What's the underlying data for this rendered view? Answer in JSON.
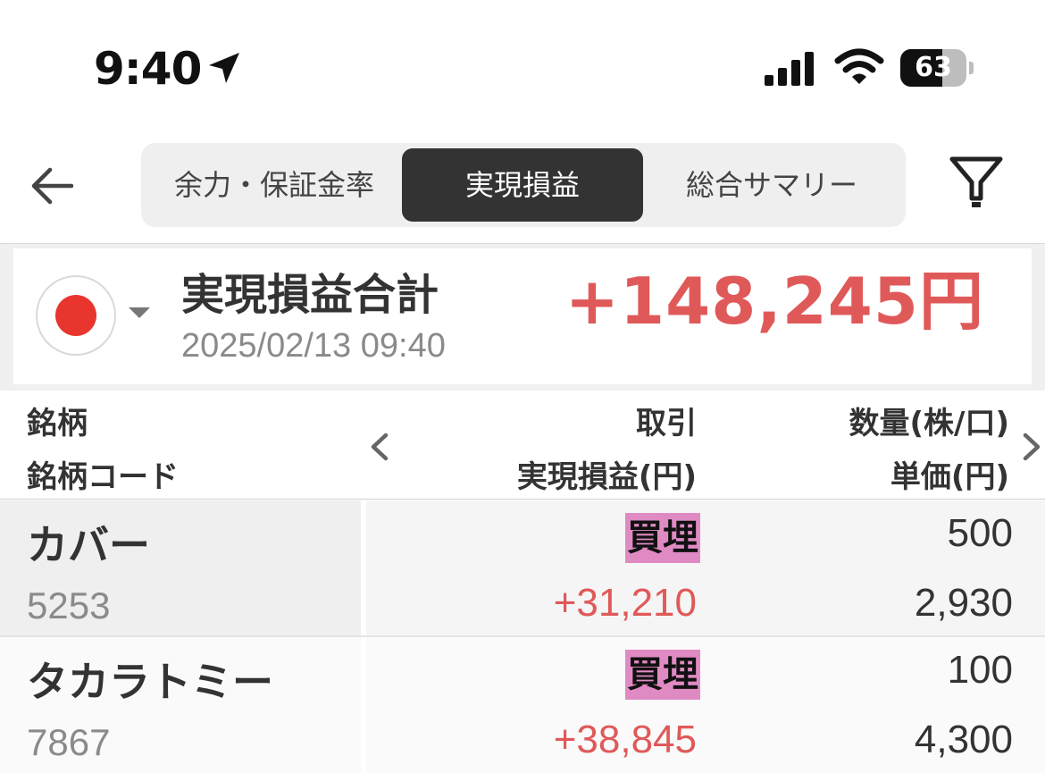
{
  "status_bar": {
    "time": "9:40",
    "battery": "63",
    "battery_level_percent": 63
  },
  "tabs": [
    {
      "label": "余力・保証金率",
      "active": false
    },
    {
      "label": "実現損益",
      "active": true
    },
    {
      "label": "総合サマリー",
      "active": false
    }
  ],
  "summary": {
    "title": "実現損益合計",
    "date": "2025/02/13 09:40",
    "amount": "+148,245円",
    "market": "Japan"
  },
  "table": {
    "headers": {
      "name": "銘柄",
      "code": "銘柄コード",
      "trade": "取引",
      "pl": "実現損益(円)",
      "qty": "数量(株/口)",
      "price": "単価(円)"
    },
    "rows": [
      {
        "name": "カバー",
        "code": "5253",
        "trade": "買埋",
        "pl": "+31,210",
        "qty": "500",
        "price": "2,930"
      },
      {
        "name": "タカラトミー",
        "code": "7867",
        "trade": "買埋",
        "pl": "+38,845",
        "qty": "100",
        "price": "4,300"
      }
    ]
  },
  "colors": {
    "positive": "#e05959",
    "badge_buy_close": "#e08ac4",
    "active_tab_bg": "#333333",
    "flag_red": "#e8352d"
  },
  "icons": [
    "location-arrow-icon",
    "signal-icon",
    "wifi-icon",
    "battery-icon",
    "back-arrow-icon",
    "filter-icon",
    "chevron-left-icon",
    "chevron-right-icon",
    "japan-flag-icon",
    "caret-down-icon"
  ]
}
